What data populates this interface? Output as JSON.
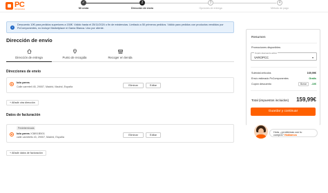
{
  "brand": {
    "name": "PC",
    "tagline": "componentes",
    "accent": "#ff6000"
  },
  "steps": [
    {
      "number": "✓",
      "label": "Mi cesta",
      "state": "done"
    },
    {
      "number": "2",
      "label": "Dirección de envío",
      "state": "active"
    },
    {
      "number": "3",
      "label": "Opciones de entrega",
      "state": "todo"
    },
    {
      "number": "4",
      "label": "Método de pago",
      "state": "todo"
    }
  ],
  "banner": {
    "text": "Descuento 10€ para pedidos superiores a 150€. Válido hasta el 25/11/2024 o fin de existencias. Limitado a 50 primeros pedidos. Válido para pedidos con productos vendidos por PcComponentes, no incluye Marketplace ni Gama Blanca. Uno por cliente."
  },
  "page_title": "Dirección de envío",
  "tabs": [
    {
      "label": "Dirección de entrega",
      "icon": "home-icon"
    },
    {
      "label": "Punto de recogida",
      "icon": "map-pin-icon"
    },
    {
      "label": "Recoger en tienda",
      "icon": "store-icon"
    }
  ],
  "shipping": {
    "title": "Direcciones de envío",
    "address": {
      "name": "Iolo peres",
      "line": "Calle carretell 45, 29007, Madrid, Madrid, España"
    },
    "delete_label": "Eliminar",
    "edit_label": "Editar",
    "add_label": "+ Añadir otra dirección"
  },
  "billing": {
    "title": "Datos de facturación",
    "tag": "Predeterminada",
    "address": {
      "name": "Iolo peres",
      "nif": "X3891B501",
      "line": "calle carretells 43, 29007, Madrid, España"
    },
    "delete_label": "Eliminar",
    "edit_label": "Editar",
    "add_label": "+ Añadir datos de facturación"
  },
  "summary": {
    "title": "Resumen",
    "promo_title": "Promociones disponibles",
    "coupon_select_label": "Cupón descuento activo",
    "coupon_value": "VAROPCC",
    "rows": [
      {
        "label": "Subtotal artículos",
        "value": "169,99€"
      },
      {
        "label": "Envío estimado PcComponentes",
        "value": "Gratis"
      },
      {
        "label": "Cupón descuento",
        "value": "-10€",
        "action": "Borrar"
      }
    ],
    "total_label": "Total (impuestos incluidos)",
    "total_value": "159,99€",
    "cta_label": "Guardar y continuar"
  },
  "help": {
    "line1": "Hola, ¿problemas con tu",
    "line2_prefix": "compra?",
    "line2_link": "Hablamos"
  }
}
